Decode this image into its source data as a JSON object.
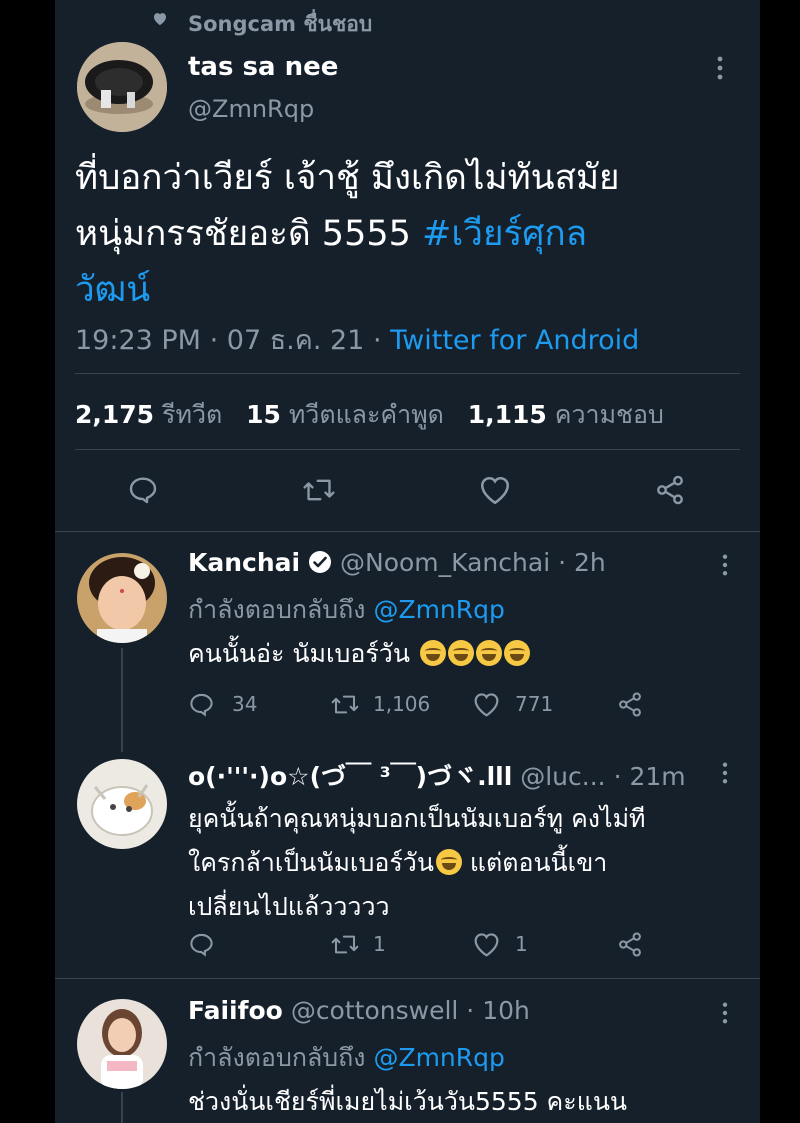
{
  "social_context": {
    "icon": "heart-icon",
    "text": "Songcam ชื่นชอบ"
  },
  "tweet": {
    "author_name": "tas sa nee",
    "author_handle": "@ZmnRqp",
    "text_line1": "ที่บอกว่าเวียร์ เจ้าชู้ มึงเกิดไม่ทันสมัย",
    "text_line2": "หนุ่มกรรชัยอะดิ  5555 ",
    "hashtag_part1": "#เวียร์ศุกล",
    "hashtag_part2": "วัฒน์",
    "time": "19:23 PM",
    "date": "07 ธ.ค. 21",
    "source": "Twitter for Android",
    "stats": {
      "retweets_count": "2,175",
      "retweets_label": "รีทวีต",
      "quotes_count": "15",
      "quotes_label": "ทวีตและคำพูด",
      "likes_count": "1,115",
      "likes_label": "ความชอบ"
    }
  },
  "replies": [
    {
      "name": "Kanchai",
      "verified": true,
      "handle": "@Noom_Kanchai",
      "time": "2h",
      "replying_to_label": "กำลังตอบกลับถึง",
      "replying_to_handle": "@ZmnRqp",
      "text": "คนนั้นอ่ะ นัมเบอร์วัน",
      "emoji": [
        "face-with-tears-of-joy",
        "face-with-tears-of-joy",
        "face-with-tears-of-joy",
        "face-with-tears-of-joy"
      ],
      "reply_count": "34",
      "retweet_count": "1,106",
      "like_count": "771"
    },
    {
      "name": "o(·'''·)o☆(づ￣ ³￣)づヾ.lll",
      "handle": "@luc...",
      "time": "21m",
      "text_line1": "ยุคนั้นถ้าคุณหนุ่มบอกเป็นนัมเบอร์ทู คงไม่ที",
      "text_line2": "ใครกล้าเป็นนัมเบอร์วัน",
      "text_line2_emoji": "grinning-squinting-face",
      "text_line2_end": " แต่ตอนนี้เขา",
      "text_line3": "เปลี่ยนไปแล้ววววว",
      "reply_count": "",
      "retweet_count": "1",
      "like_count": "1"
    },
    {
      "name": "Faiifoo",
      "handle": "@cottonswell",
      "time": "10h",
      "replying_to_label": "กำลังตอบกลับถึง",
      "replying_to_handle": "@ZmnRqp",
      "text": "ช่วงนั่นเชียร์พี่เมยไม่เว้นวัน5555 คะแนน"
    }
  ],
  "separator": "·",
  "colors": {
    "background": "#15202b",
    "accent": "#1d9bf0",
    "secondary_text": "#8b98a5",
    "divider": "#38444d"
  }
}
